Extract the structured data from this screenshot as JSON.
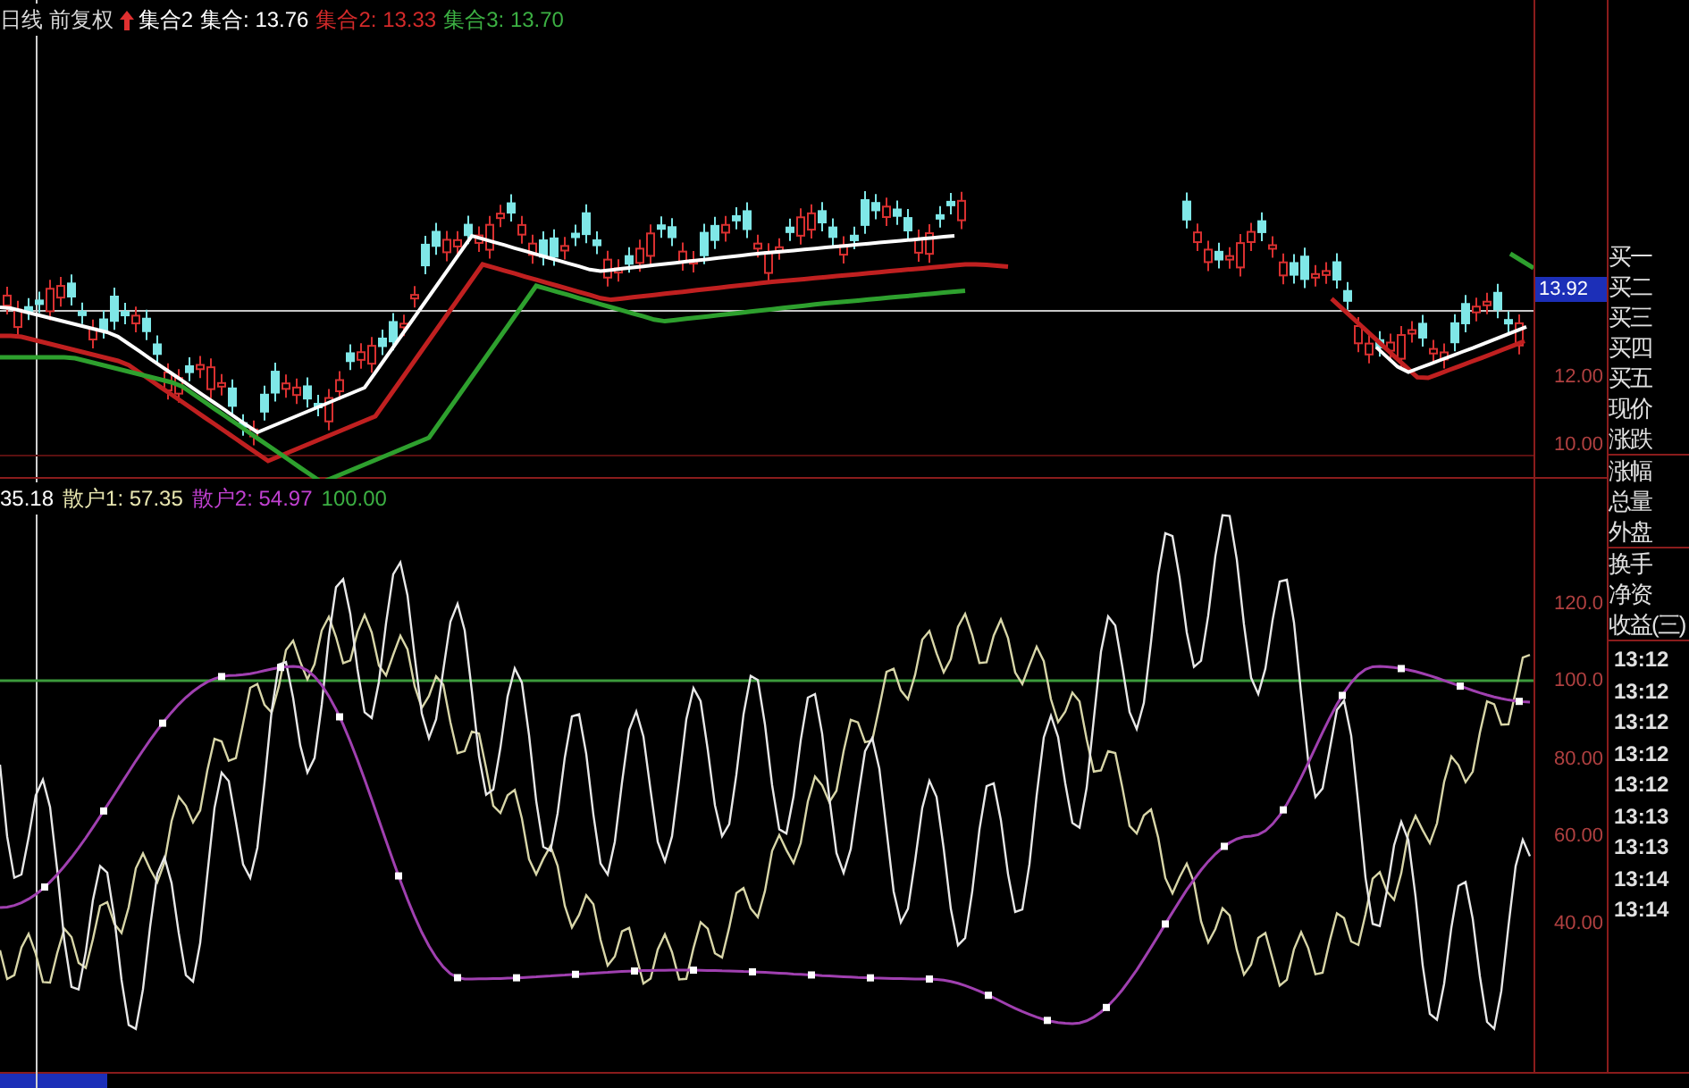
{
  "top_legend": {
    "title": "日线 前复权",
    "items": [
      {
        "text": "集合2",
        "color": "#ffffff",
        "kind": "arrow"
      },
      {
        "text": "集合: 13.76",
        "color": "#ffffff",
        "kind": "plain"
      },
      {
        "text": "集合2: 13.33",
        "color": "#d42a2a",
        "kind": "plain"
      },
      {
        "text": "集合3: 13.70",
        "color": "#3cb043",
        "kind": "plain"
      }
    ]
  },
  "price_axis": [
    {
      "text": "13.92",
      "selected": true
    },
    {
      "text": "12.00",
      "selected": false
    },
    {
      "text": "10.00",
      "selected": false
    }
  ],
  "bottom_legend": {
    "items": [
      {
        "text": "35.18",
        "color": "#ffffff"
      },
      {
        "text": "散户1: 57.35",
        "color": "#e8e6b0"
      },
      {
        "text": "散户2: 54.97",
        "color": "#c040d0"
      },
      {
        "text": "100.00",
        "color": "#3cb043"
      }
    ]
  },
  "indicator_axis": [
    "120.0",
    "100.0",
    "80.00",
    "60.00",
    "40.00"
  ],
  "quote_labels": [
    {
      "text": "买一"
    },
    {
      "text": "买二"
    },
    {
      "text": "买三"
    },
    {
      "text": "买四"
    },
    {
      "text": "买五"
    },
    {
      "text": "现价"
    },
    {
      "text": "涨跌",
      "divider_after": true
    },
    {
      "text": "涨幅"
    },
    {
      "text": "总量"
    },
    {
      "text": "外盘",
      "divider_after": true
    },
    {
      "text": "换手"
    },
    {
      "text": "净资"
    },
    {
      "text": "收益(三)",
      "divider_after": true
    }
  ],
  "trade_times": [
    "13:12",
    "13:12",
    "13:12",
    "13:12",
    "13:12",
    "13:13",
    "13:13",
    "13:14",
    "13:14"
  ]
}
